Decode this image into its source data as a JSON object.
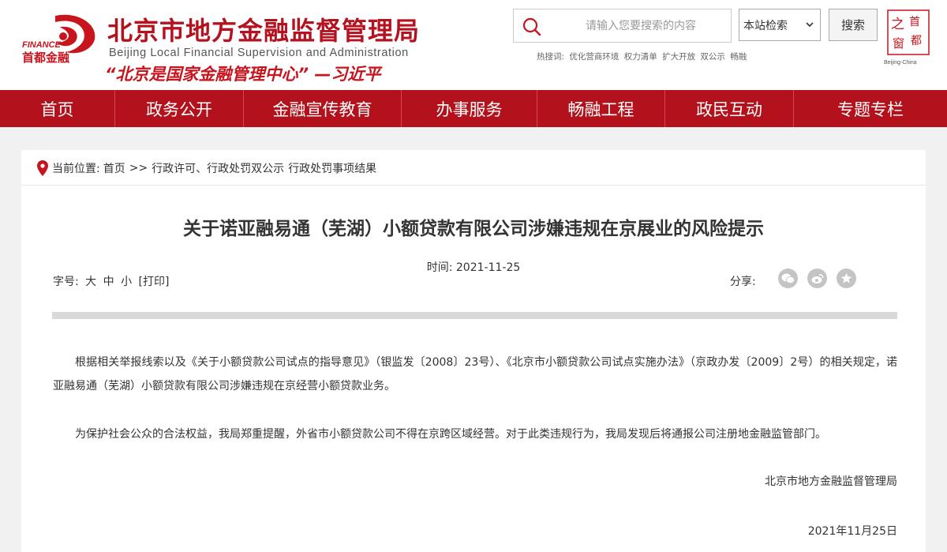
{
  "header": {
    "logo_badge_text": "FINANCE",
    "logo_cn": "首都金融",
    "title": "北京市地方金融监督管理局",
    "title_en": "Beijing Local Financial Supervision and Administration",
    "slogan": "“北京是国家金融管理中心”  —习近平",
    "search": {
      "placeholder": "请输入您要搜索的内容",
      "scope": "本站检索",
      "button": "搜索"
    },
    "hot_words": {
      "label": "热搜词:",
      "items": [
        "优化营商环境",
        "权力清单",
        "扩大开放",
        "双公示",
        "畅融"
      ]
    },
    "capital_logo": {
      "chars": [
        "之",
        "首",
        "都",
        "窗"
      ],
      "caption": "Beijing-China"
    }
  },
  "nav": {
    "items": [
      "首页",
      "政务公开",
      "金融宣传教育",
      "办事服务",
      "畅融工程",
      "政民互动",
      "专题专栏"
    ]
  },
  "breadcrumb": {
    "label": "当前位置:",
    "home": "首页",
    "sep": ">>",
    "section": "行政许可、行政处罚双公示",
    "page": "行政处罚事项结果"
  },
  "article": {
    "title": "关于诺亚融易通（芜湖）小额贷款有限公司涉嫌违规在京展业的风险提示",
    "time": "时间: 2021-11-25",
    "font_size": {
      "label": "字号:",
      "large": "大",
      "medium": "中",
      "small": "小",
      "print": "[打印]"
    },
    "share_label": "分享:",
    "paragraphs": [
      "根据相关举报线索以及《关于小额贷款公司试点的指导意见》（银监发〔2008〕23号）、《北京市小额贷款公司试点实施办法》（京政办发〔2009〕2号）的相关规定，诺亚融易通（芜湖）小额贷款有限公司涉嫌违规在京经营小额贷款业务。",
      "为保护社会公众的合法权益，我局郑重提醒，外省市小额贷款公司不得在京跨区域经营。对于此类违规行为，我局发现后将通报公司注册地金融监管部门。"
    ],
    "signature": "北京市地方金融监督管理局",
    "date": "2021年11月25日"
  },
  "icons": {
    "search": "search-icon",
    "pin": "location-pin-icon",
    "wechat": "wechat-icon",
    "weibo": "weibo-icon",
    "favorite": "star-icon"
  },
  "colors": {
    "brand_red": "#b3121c",
    "title_red": "#b51220"
  }
}
